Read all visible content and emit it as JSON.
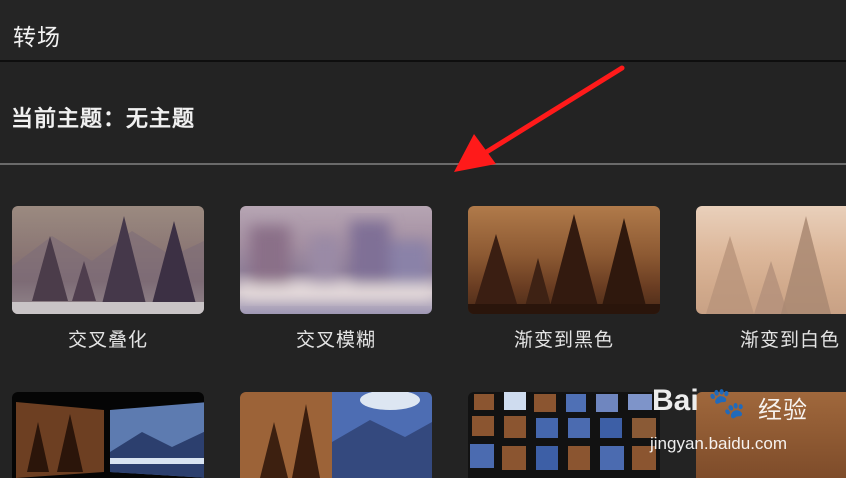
{
  "header": {
    "title": "转场"
  },
  "theme": {
    "label": "当前主题：无主题"
  },
  "transitions": [
    {
      "label": "交叉叠化"
    },
    {
      "label": "交叉模糊"
    },
    {
      "label": "渐变到黑色"
    },
    {
      "label": "渐变到白色"
    }
  ],
  "second_row_count_visible": 4,
  "annotation": {
    "icon": "red-arrow",
    "color": "#ff1a1a"
  },
  "watermark": {
    "brand": "Bai",
    "paw": "🐾",
    "site_cn": "经验",
    "url": "jingyan.baidu.com"
  }
}
